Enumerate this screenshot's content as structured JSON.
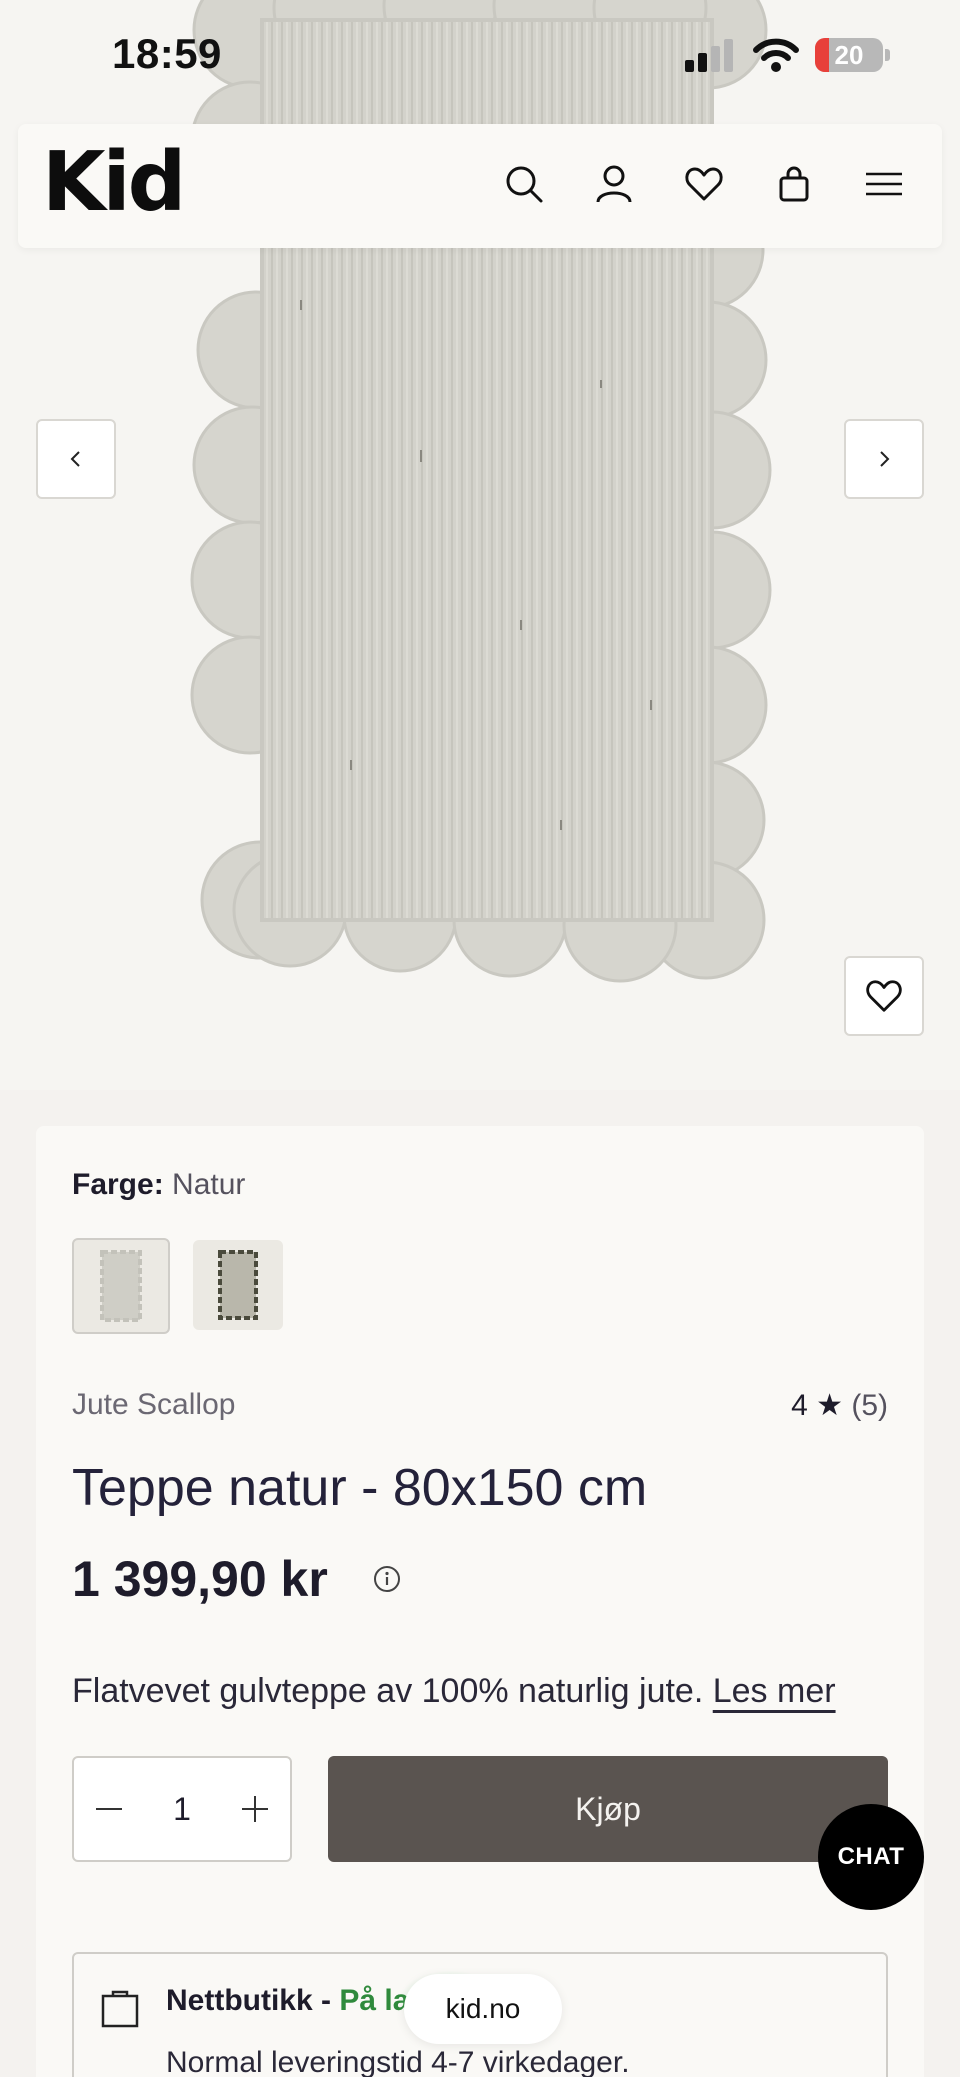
{
  "status_bar": {
    "time": "18:59",
    "battery": "20"
  },
  "header": {
    "logo": "Kid"
  },
  "product": {
    "color_label": "Farge:",
    "color_value": "Natur",
    "brand": "Jute Scallop",
    "rating": "4 ★",
    "rating_count": "(5)",
    "title": "Teppe natur - 80x150 cm",
    "price": "1 399,90 kr",
    "description": "Flatvevet gulvteppe av 100% naturlig jute.",
    "read_more": "Les mer",
    "quantity": "1",
    "buy_label": "Kjøp"
  },
  "store": {
    "title": "Nettbutikk - ",
    "status": "På lager",
    "subtitle": "Normal leveringstid 4-7 virkedager."
  },
  "chat_label": "CHAT",
  "browser": {
    "url": "kid.no"
  },
  "colors": {
    "buy_button": "#5a5450",
    "in_stock": "#2f8a3c",
    "chat": "#000000"
  }
}
